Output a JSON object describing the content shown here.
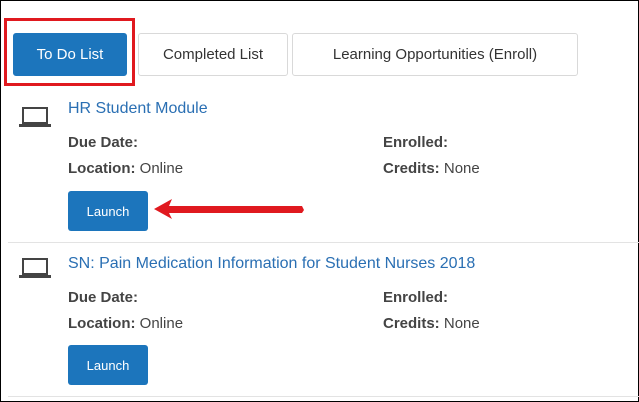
{
  "tabs": [
    {
      "label": "To Do List",
      "active": true
    },
    {
      "label": "Completed List",
      "active": false
    },
    {
      "label": "Learning Opportunities (Enroll)",
      "active": false
    }
  ],
  "courses": [
    {
      "icon": "laptop-icon",
      "title": "HR Student Module",
      "due_date_label": "Due Date:",
      "due_date_value": "",
      "enrolled_label": "Enrolled:",
      "enrolled_value": "",
      "location_label": "Location:",
      "location_value": "Online",
      "credits_label": "Credits:",
      "credits_value": "None",
      "launch_label": "Launch"
    },
    {
      "icon": "laptop-icon",
      "title": "SN: Pain Medication Information for Student Nurses 2018",
      "due_date_label": "Due Date:",
      "due_date_value": "",
      "enrolled_label": "Enrolled:",
      "enrolled_value": "",
      "location_label": "Location:",
      "location_value": "Online",
      "credits_label": "Credits:",
      "credits_value": "None",
      "launch_label": "Launch"
    }
  ],
  "colors": {
    "accent": "#1c75bc",
    "link": "#2a6fb3",
    "annotation": "#e0191f"
  }
}
